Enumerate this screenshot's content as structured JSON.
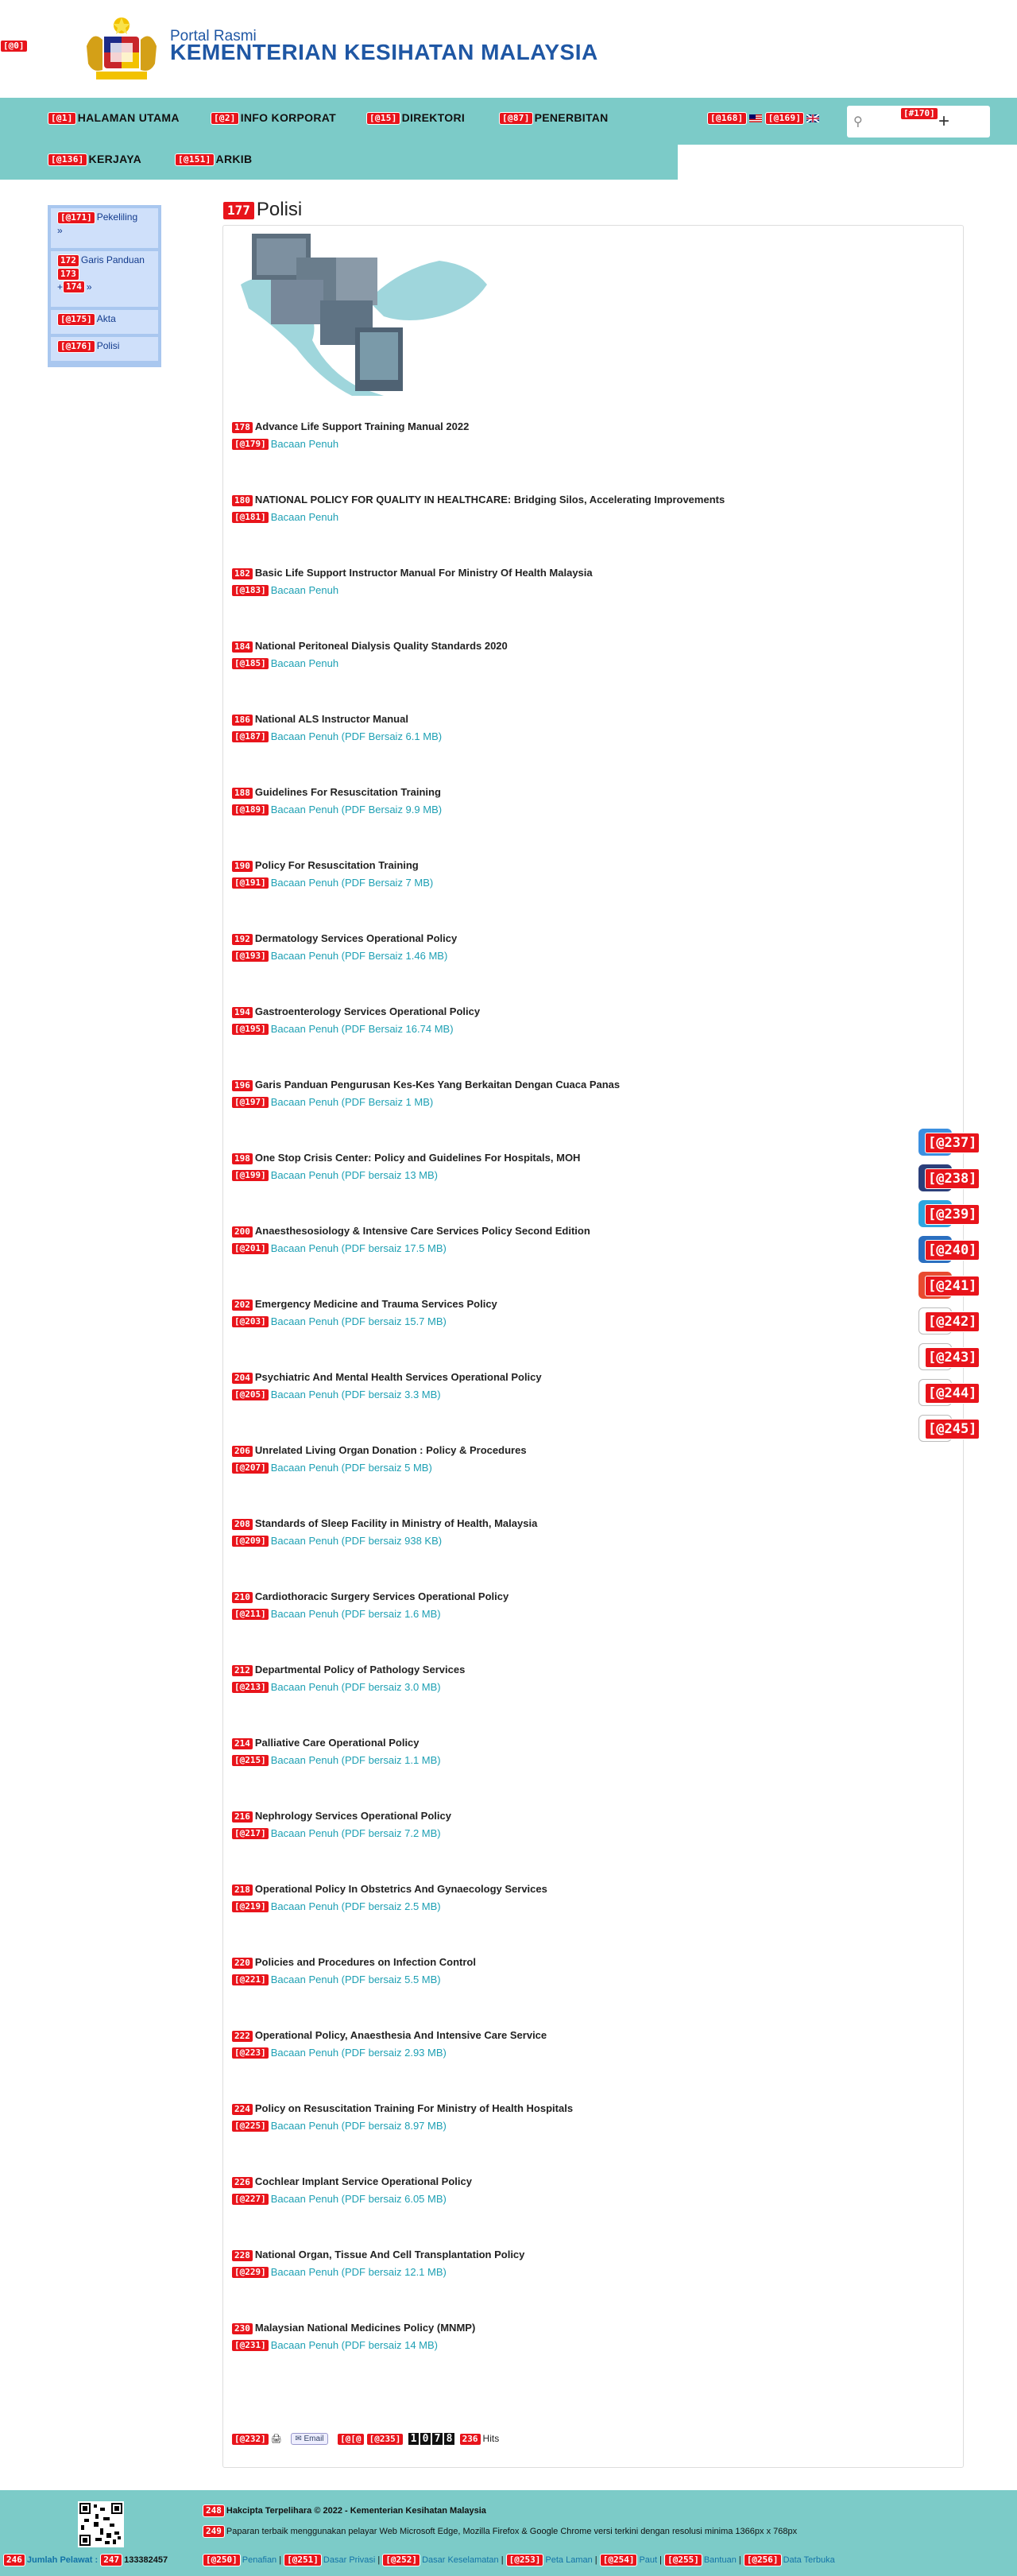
{
  "header": {
    "tag_root": "[@0]",
    "portal_label": "Portal Rasmi",
    "ministry_name": "KEMENTERIAN KESIHATAN MALAYSIA"
  },
  "nav": [
    {
      "tag": "[@1]",
      "label": "HALAMAN UTAMA"
    },
    {
      "tag": "[@2]",
      "label": "INFO KORPORAT"
    },
    {
      "tag": "[@15]",
      "label": "DIREKTORI"
    },
    {
      "tag": "[@87]",
      "label": "PENERBITAN"
    },
    {
      "tag": "[@136]",
      "label": "KERJAYA"
    },
    {
      "tag": "[@151]",
      "label": "ARKIB"
    }
  ],
  "lang": {
    "tag_ms": "[@168]",
    "tag_en": "[@169]"
  },
  "search": {
    "tag": "[#170]",
    "placeholder": "",
    "icon": "search-icon"
  },
  "sidebar": [
    {
      "tag": "[@171]",
      "label": "Pekeliling",
      "suffix": "»"
    },
    {
      "tag": "172",
      "label": "Garis Panduan",
      "tag2": "173",
      "tag3": "174",
      "suffix": "»"
    },
    {
      "tag": "[@175]",
      "label": "Akta"
    },
    {
      "tag": "[@176]",
      "label": "Polisi"
    }
  ],
  "content": {
    "title_tag": "177",
    "title": "Polisi"
  },
  "policies": [
    {
      "tag": "178",
      "title": "Advance Life Support Training Manual 2022",
      "link_tag": "[@179]",
      "link": "Bacaan Penuh"
    },
    {
      "tag": "180",
      "title": "NATIONAL POLICY FOR QUALITY IN HEALTHCARE: Bridging Silos, Accelerating Improvements",
      "link_tag": "[@181]",
      "link": "Bacaan Penuh"
    },
    {
      "tag": "182",
      "title": "Basic Life Support Instructor Manual For Ministry Of Health Malaysia",
      "link_tag": "[@183]",
      "link": "Bacaan Penuh"
    },
    {
      "tag": "184",
      "title": "National Peritoneal Dialysis Quality Standards 2020",
      "link_tag": "[@185]",
      "link": "Bacaan Penuh"
    },
    {
      "tag": "186",
      "title": "National ALS Instructor Manual",
      "link_tag": "[@187]",
      "link": "Bacaan Penuh (PDF Bersaiz 6.1 MB)"
    },
    {
      "tag": "188",
      "title": "Guidelines For Resuscitation Training",
      "link_tag": "[@189]",
      "link": "Bacaan Penuh (PDF Bersaiz 9.9 MB)"
    },
    {
      "tag": "190",
      "title": "Policy For Resuscitation Training",
      "link_tag": "[@191]",
      "link": "Bacaan Penuh (PDF Bersaiz 7 MB)"
    },
    {
      "tag": "192",
      "title": "Dermatology Services Operational Policy",
      "link_tag": "[@193]",
      "link": "Bacaan Penuh (PDF Bersaiz 1.46 MB)"
    },
    {
      "tag": "194",
      "title": "Gastroenterology Services Operational Policy",
      "link_tag": "[@195]",
      "link": "Bacaan Penuh (PDF Bersaiz 16.74 MB)"
    },
    {
      "tag": "196",
      "title": "Garis Panduan Pengurusan Kes-Kes Yang Berkaitan Dengan Cuaca Panas",
      "link_tag": "[@197]",
      "link": "Bacaan Penuh (PDF Bersaiz 1 MB)"
    },
    {
      "tag": "198",
      "title": "One Stop Crisis Center: Policy and Guidelines For Hospitals, MOH",
      "link_tag": "[@199]",
      "link": "Bacaan Penuh (PDF bersaiz 13 MB)"
    },
    {
      "tag": "200",
      "title": "Anaesthesosiology & Intensive Care Services Policy Second Edition",
      "link_tag": "[@201]",
      "link": "Bacaan Penuh (PDF bersaiz 17.5 MB)"
    },
    {
      "tag": "202",
      "title": "Emergency Medicine and Trauma Services Policy",
      "link_tag": "[@203]",
      "link": "Bacaan Penuh (PDF bersaiz 15.7 MB)"
    },
    {
      "tag": "204",
      "title": "Psychiatric And Mental Health Services Operational Policy",
      "link_tag": "[@205]",
      "link": "Bacaan Penuh (PDF bersaiz 3.3 MB)"
    },
    {
      "tag": "206",
      "title": "Unrelated Living Organ Donation : Policy & Procedures",
      "link_tag": "[@207]",
      "link": "Bacaan Penuh (PDF bersaiz 5 MB)"
    },
    {
      "tag": "208",
      "title": "Standards of Sleep Facility in Ministry of Health, Malaysia",
      "link_tag": "[@209]",
      "link": "Bacaan Penuh (PDF bersaiz 938 KB)"
    },
    {
      "tag": "210",
      "title": "Cardiothoracic Surgery Services Operational Policy",
      "link_tag": "[@211]",
      "link": "Bacaan Penuh (PDF bersaiz 1.6 MB)"
    },
    {
      "tag": "212",
      "title": "Departmental Policy of Pathology Services",
      "link_tag": "[@213]",
      "link": "Bacaan Penuh (PDF bersaiz 3.0 MB)"
    },
    {
      "tag": "214",
      "title": "Palliative Care Operational Policy",
      "link_tag": "[@215]",
      "link": "Bacaan Penuh (PDF bersaiz 1.1 MB)"
    },
    {
      "tag": "216",
      "title": "Nephrology Services Operational Policy",
      "link_tag": "[@217]",
      "link": "Bacaan Penuh (PDF bersaiz 7.2 MB)"
    },
    {
      "tag": "218",
      "title": "Operational Policy In Obstetrics And Gynaecology Services",
      "link_tag": "[@219]",
      "link": "Bacaan Penuh (PDF bersaiz 2.5 MB)"
    },
    {
      "tag": "220",
      "title": "Policies and Procedures on Infection Control",
      "link_tag": "[@221]",
      "link": "Bacaan Penuh (PDF bersaiz 5.5 MB)"
    },
    {
      "tag": "222",
      "title": "Operational Policy, Anaesthesia And Intensive Care Service",
      "link_tag": "[@223]",
      "link": "Bacaan Penuh (PDF bersaiz 2.93 MB)"
    },
    {
      "tag": "224",
      "title": "Policy on Resuscitation Training For Ministry of Health Hospitals",
      "link_tag": "[@225]",
      "link": "Bacaan Penuh (PDF bersaiz 8.97 MB)"
    },
    {
      "tag": "226",
      "title": "Cochlear Implant Service Operational Policy",
      "link_tag": "[@227]",
      "link": "Bacaan Penuh (PDF bersaiz 6.05 MB)"
    },
    {
      "tag": "228",
      "title": "National Organ, Tissue And Cell Transplantation Policy",
      "link_tag": "[@229]",
      "link": "Bacaan Penuh (PDF bersaiz 12.1 MB)"
    },
    {
      "tag": "230",
      "title": "Malaysian National Medicines Policy (MNMP)",
      "link_tag": "[@231]",
      "link": "Bacaan Penuh (PDF bersaiz 14 MB)"
    }
  ],
  "content_footer": {
    "print_tag": "[@232]",
    "email_label": "Email",
    "tag_233": "[@[@",
    "tag_235": "[@235]",
    "hits_digits": [
      "1",
      "0",
      "7",
      "8"
    ],
    "hits_tag": "236",
    "hits_label": "Hits"
  },
  "social": [
    {
      "tag": "[@237]",
      "color": "#3b8fe0",
      "icon": "facebook-icon"
    },
    {
      "tag": "[@238]",
      "color": "#2b3f7a",
      "icon": "twitter-icon"
    },
    {
      "tag": "[@239]",
      "color": "#2ea5e0",
      "icon": "telegram-icon"
    },
    {
      "tag": "[@240]",
      "color": "#2b6fc0",
      "icon": "linkedin-icon"
    },
    {
      "tag": "[@241]",
      "color": "#e84a30",
      "icon": "google-plus-icon"
    },
    {
      "tag": "[@242]",
      "color": "#ffffff",
      "icon": "share-icon"
    },
    {
      "tag": "[@243]",
      "color": "#ffffff",
      "icon": "print-icon"
    },
    {
      "tag": "[@244]",
      "color": "#ffffff",
      "icon": "mail-icon"
    },
    {
      "tag": "[@245]",
      "color": "#ffffff",
      "icon": "bookmark-icon"
    }
  ],
  "footer": {
    "copyright_tag": "248",
    "copyright": "Hakcipta Terpelihara © 2022 - Kementerian Kesihatan Malaysia",
    "browser_tag": "249",
    "browser_note": "Paparan terbaik menggunakan pelayar Web Microsoft Edge, Mozilla Firefox & Google Chrome versi terkini dengan resolusi minima 1366px x 768px",
    "visitor_tag": "246",
    "visitor_label": "Jumlah Pelawat :",
    "visitor_count_tag": "247",
    "visitor_count": "133382457",
    "links": [
      {
        "tag": "[@250]",
        "label": "Penafian"
      },
      {
        "tag": "[@251]",
        "label": "Dasar Privasi"
      },
      {
        "tag": "[@252]",
        "label": "Dasar Keselamatan"
      },
      {
        "tag": "[@253]",
        "label": "Peta Laman"
      },
      {
        "tag": "[@254]",
        "label": "Paut"
      },
      {
        "tag": "[@255]",
        "label": "Bantuan"
      },
      {
        "tag": "[@256]",
        "label": "Data Terbuka"
      }
    ]
  }
}
